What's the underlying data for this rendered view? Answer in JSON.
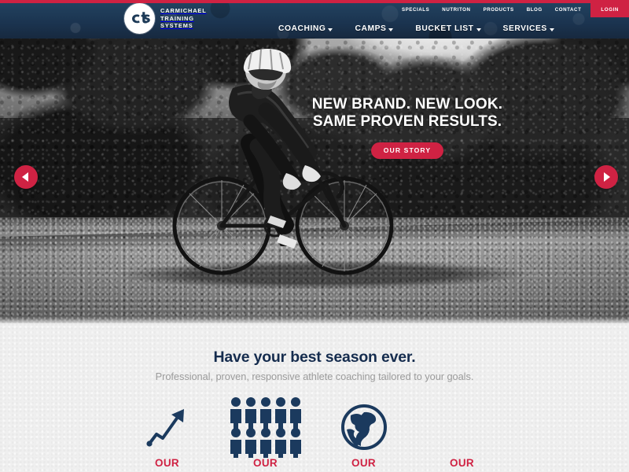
{
  "brand": {
    "logo_icon": "cts-circle-logo",
    "logo_mark_text": "cts",
    "name_lines": "Carmichael\nTraining\nSystems"
  },
  "colors": {
    "crimson": "#cf2243",
    "navy": "#152c4e",
    "header_navy": "#1d3a57",
    "section_bg": "#efefef",
    "subtitle_gray": "#9b9b9b"
  },
  "utility_nav": {
    "items": [
      {
        "label": "Specials"
      },
      {
        "label": "Nutriton"
      },
      {
        "label": "Products"
      },
      {
        "label": "Blog"
      },
      {
        "label": "Contact"
      }
    ],
    "login_label": "Login"
  },
  "main_nav": {
    "items": [
      {
        "label": "Coaching",
        "has_dropdown": true
      },
      {
        "label": "Camps",
        "has_dropdown": true
      },
      {
        "label": "Bucket List",
        "has_dropdown": true
      },
      {
        "label": "Services",
        "has_dropdown": true
      }
    ]
  },
  "hero": {
    "headline_line1": "New Brand. New Look.",
    "headline_line2": "Same Proven Results.",
    "cta_label": "Our Story",
    "prev_icon": "chevron-left-icon",
    "next_icon": "chevron-right-icon",
    "image_alt": "Cyclist riding a road bike on a tree-lined road, black and white"
  },
  "intro": {
    "heading": "Have your best season ever.",
    "subheading": "Professional, proven, responsive athlete coaching tailored to your goals."
  },
  "features": [
    {
      "icon": "trend-arrow-icon",
      "label": "Our"
    },
    {
      "icon": "people-group-icon",
      "label": "Our"
    },
    {
      "icon": "globe-icon",
      "label": "Our"
    },
    {
      "icon": "feature-icon",
      "label": "Our"
    }
  ]
}
